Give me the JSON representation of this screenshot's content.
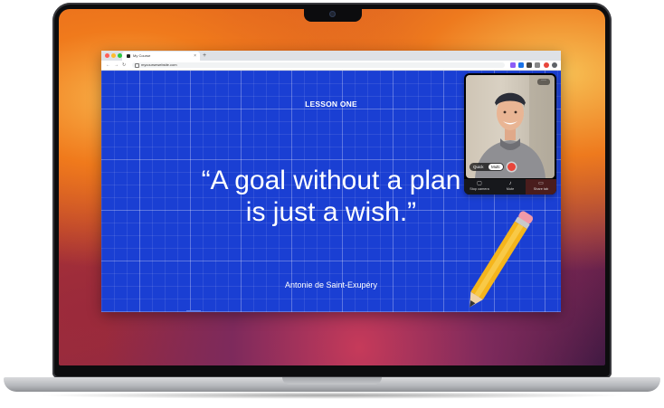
{
  "browser": {
    "tab_title": "My Course",
    "tab_close": "×",
    "new_tab": "+",
    "url": "mycoursewebsite.com",
    "nav": {
      "back": "←",
      "forward": "→",
      "reload": "↻"
    }
  },
  "slide": {
    "heading": "LESSON ONE",
    "quote_line1": "“A goal without a plan",
    "quote_line2": "is just a wish.”",
    "author": "Antonie de Saint-Exupéry"
  },
  "recorder": {
    "more": "···",
    "mode_quick": "Quick",
    "mode_multi": "Multi",
    "controls": [
      {
        "label": "Stop camera",
        "icon": "camera-icon"
      },
      {
        "label": "Mute",
        "icon": "microphone-icon"
      },
      {
        "label": "Share tab",
        "icon": "screen-share-icon"
      }
    ]
  },
  "colors": {
    "slide_bg": "#1a3fd3",
    "record": "#e8463b",
    "pencil": "#f5b51c"
  }
}
